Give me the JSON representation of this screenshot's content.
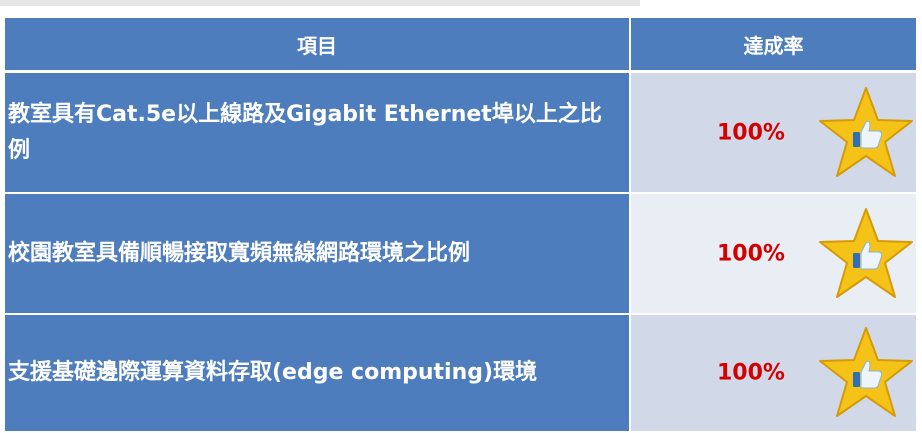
{
  "table": {
    "headers": {
      "item": "項目",
      "rate": "達成率"
    },
    "rows": [
      {
        "item": "教室具有Cat.5e以上線路及Gigabit Ethernet埠以上之比例",
        "rate": "100%",
        "icon": "star-thumbs-up-icon"
      },
      {
        "item": "校園教室具備順暢接取寬頻無線網路環境之比例",
        "rate": "100%",
        "icon": "star-thumbs-up-icon"
      },
      {
        "item": "支援基礎邊際運算資料存取(edge computing)環境",
        "rate": "100%",
        "icon": "star-thumbs-up-icon"
      }
    ]
  },
  "colors": {
    "header_bg": "#4e7dbd",
    "rate_bg_dark": "#d1d9e8",
    "rate_bg_light": "#e9edf4",
    "rate_text": "#d40000",
    "star": "#f5c218"
  }
}
